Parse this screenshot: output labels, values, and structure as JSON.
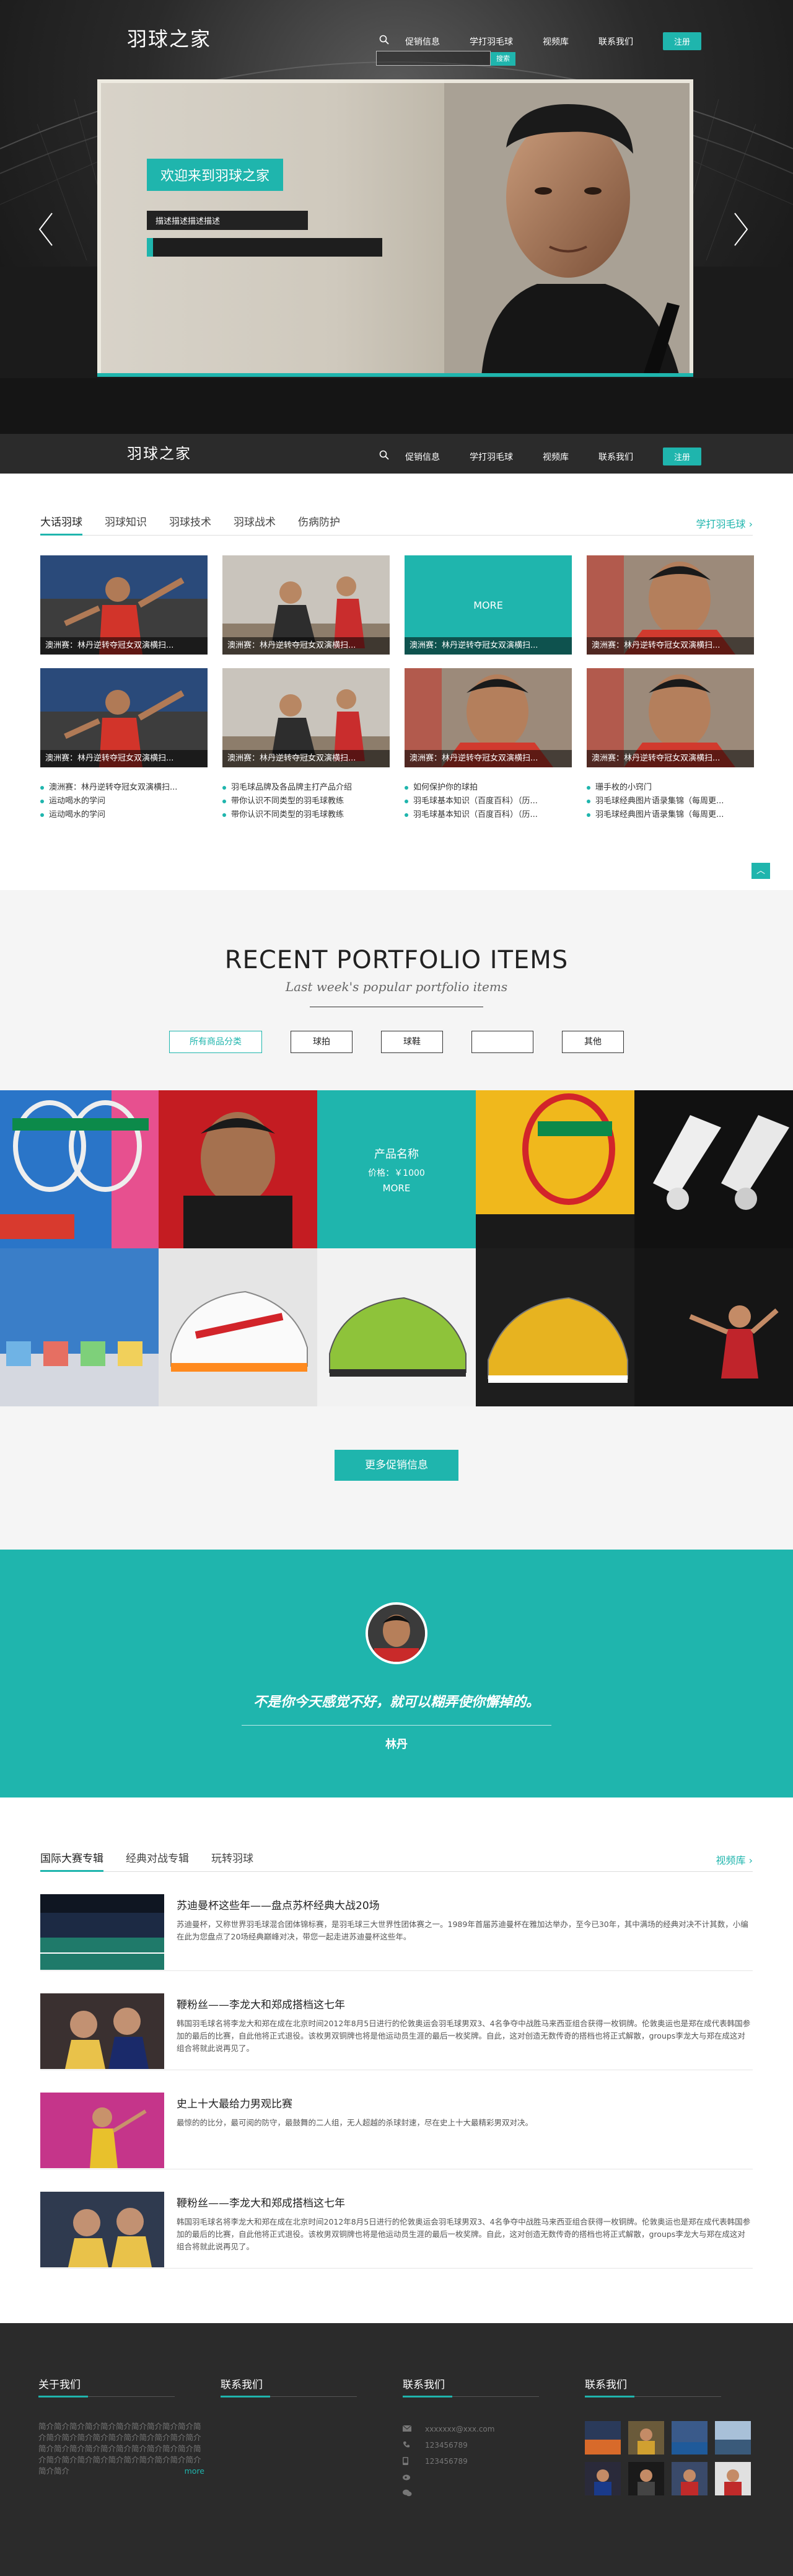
{
  "site": {
    "logo": "羽球之家",
    "nav": [
      "促销信息",
      "学打羽毛球",
      "视频库",
      "联系我们"
    ],
    "register": "注册",
    "search_button": "搜索"
  },
  "hero": {
    "title": "欢迎来到羽球之家",
    "description": "描述描述描述描述"
  },
  "knowledge": {
    "tabs": [
      "大话羽球",
      "羽球知识",
      "羽球技术",
      "羽球战术",
      "伤病防护"
    ],
    "more": "学打羽毛球",
    "thumbs_row1": [
      {
        "caption": "澳洲赛：林丹逆转夺冠女双演横扫...",
        "img": "player-red"
      },
      {
        "caption": "澳洲赛：林丹逆转夺冠女双演横扫...",
        "img": "player-gym"
      },
      {
        "caption": "澳洲赛：林丹逆转夺冠女双演横扫...",
        "img": "more",
        "overlay": "MORE"
      },
      {
        "caption": "澳洲赛：林丹逆转夺冠女双演横扫...",
        "img": "portrait"
      }
    ],
    "thumbs_row2": [
      {
        "caption": "澳洲赛：林丹逆转夺冠女双演横扫...",
        "img": "player-red"
      },
      {
        "caption": "澳洲赛：林丹逆转夺冠女双演横扫...",
        "img": "player-gym"
      },
      {
        "caption": "澳洲赛：林丹逆转夺冠女双演横扫...",
        "img": "portrait"
      },
      {
        "caption": "澳洲赛：林丹逆转夺冠女双演横扫...",
        "img": "portrait"
      }
    ],
    "lists": [
      [
        "澳洲赛：林丹逆转夺冠女双演横扫...",
        "运动喝水的学问",
        "运动喝水的学问"
      ],
      [
        "羽毛球品牌及各品牌主打产品介绍",
        "带你认识不同类型的羽毛球教练",
        "带你认识不同类型的羽毛球教练"
      ],
      [
        "如何保护你的球拍",
        "羽毛球基本知识（百度百科）（历...",
        "羽毛球基本知识（百度百科）（历..."
      ],
      [
        "珊手枚的小窍门",
        "羽毛球经典图片语录集锦（每周更...",
        "羽毛球经典图片语录集锦（每周更..."
      ]
    ]
  },
  "portfolio": {
    "title": "RECENT PORTFOLIO ITEMS",
    "subtitle": "Last week's popular portfolio items",
    "filters": [
      "所有商品分类",
      "球拍",
      "球鞋",
      "",
      "其他"
    ],
    "overlay": {
      "name": "产品名称",
      "price": "价格：￥1000",
      "more": "MORE"
    },
    "more_button": "更多促销信息"
  },
  "quote": {
    "text": "不是你今天感觉不好，就可以糊弄使你懈掉的。",
    "author": "林丹"
  },
  "news": {
    "tabs": [
      "国际大赛专辑",
      "经典对战专辑",
      "玩转羽球"
    ],
    "more": "视频库",
    "items": [
      {
        "title": "苏迪曼杯这些年——盘点苏杯经典大战20场",
        "text": "苏迪曼杯，又称世界羽毛球混合团体锦标赛，是羽毛球三大世界性团体赛之一。1989年首届苏迪曼杯在雅加达举办，至今已30年，其中满场的经典对决不计其数，小编在此为您盘点了20场经典巅峰对决，带您一起走进苏迪曼杯这些年。",
        "img": "court"
      },
      {
        "title": "鞭粉丝——李龙大和郑成搭档这七年",
        "text": "韩国羽毛球名将李龙大和郑在成在北京时间2012年8月5日进行的伦敦奥运会羽毛球男双3、4名争夺中战胜马来西亚组合获得一枚铜牌。伦敦奥运也是郑在成代表韩国参加的最后的比赛，自此他将正式退役。该枚男双铜牌也将是他运动员生涯的最后一枚奖牌。自此，这对创造无数传奇的搭档也将正式解散，groups李龙大与郑在成这对组合将就此说再见了。",
        "img": "duo"
      },
      {
        "title": "史上十大最给力男观比赛",
        "text": "最惊的的比分，最可阅的防守，最鼓舞的二人组，无人超越的杀球封速，尽在史上十大最精彩男双对决。",
        "img": "gold"
      },
      {
        "title": "鞭粉丝——李龙大和郑成搭档这七年",
        "text": "韩国羽毛球名将李龙大和郑在成在北京时间2012年8月5日进行的伦敦奥运会羽毛球男双3、4名争夺中战胜马来西亚组合获得一枚铜牌。伦敦奥运也是郑在成代表韩国参加的最后的比赛，自此他将正式退役。该枚男双铜牌也将是他运动员生涯的最后一枚奖牌。自此，这对创造无数传奇的搭档也将正式解散，groups李龙大与郑在成这对组合将就此说再见了。",
        "img": "duo2"
      }
    ]
  },
  "footer": {
    "titles": [
      "关于我们",
      "联系我们",
      "联系我们",
      "联系我们"
    ],
    "about": "简介简介简介简介简介简介简介简介简介简介简介简介简介简介简介简介简介简介简介简介简介简介简介简介简介简介简介简介简介简介简介简介简介简介简介简介简介简介简介简介简介简介简介简介",
    "about_more": "more",
    "contact": [
      "xxxxxxx@xxx.com",
      "123456789",
      "123456789",
      "",
      ""
    ]
  }
}
